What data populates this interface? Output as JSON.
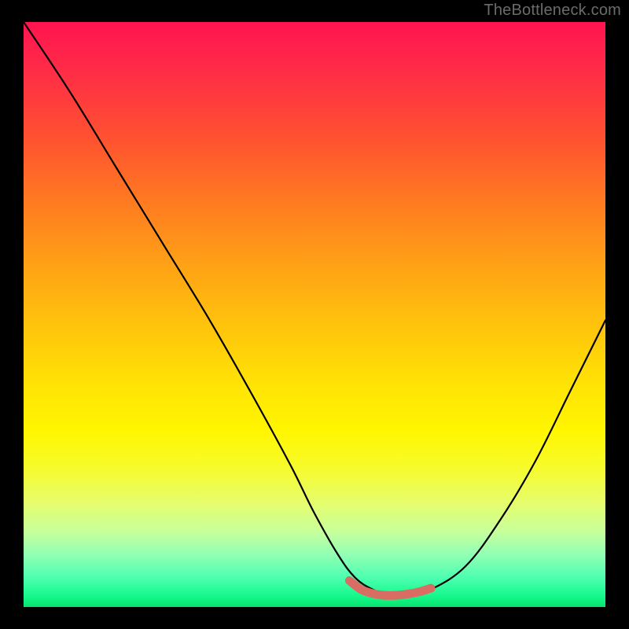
{
  "watermark": "TheBottleneck.com",
  "chart_data": {
    "type": "line",
    "title": "",
    "xlabel": "",
    "ylabel": "",
    "xlim": [
      0,
      100
    ],
    "ylim": [
      0,
      100
    ],
    "series": [
      {
        "name": "bottleneck-curve",
        "x": [
          0,
          8,
          16,
          24,
          32,
          40,
          46,
          50,
          54,
          57,
          60,
          63,
          66,
          70,
          76,
          82,
          88,
          94,
          100
        ],
        "values": [
          100,
          88,
          75,
          62,
          49,
          35,
          24,
          16,
          9,
          5,
          3,
          2,
          2,
          3,
          7,
          15,
          25,
          37,
          49
        ]
      },
      {
        "name": "optimal-band",
        "x": [
          56,
          58,
          60,
          62,
          64,
          66,
          68,
          70
        ],
        "values": [
          4.5,
          3.0,
          2.3,
          2.0,
          2.0,
          2.2,
          2.6,
          3.2
        ]
      }
    ],
    "gradient_stops": [
      {
        "pct": 0,
        "color": "#ff1450"
      },
      {
        "pct": 20,
        "color": "#ff5230"
      },
      {
        "pct": 42,
        "color": "#ffa315"
      },
      {
        "pct": 62,
        "color": "#ffe305"
      },
      {
        "pct": 82,
        "color": "#e7fd6a"
      },
      {
        "pct": 95,
        "color": "#4dffb0"
      },
      {
        "pct": 100,
        "color": "#06e56e"
      }
    ]
  }
}
